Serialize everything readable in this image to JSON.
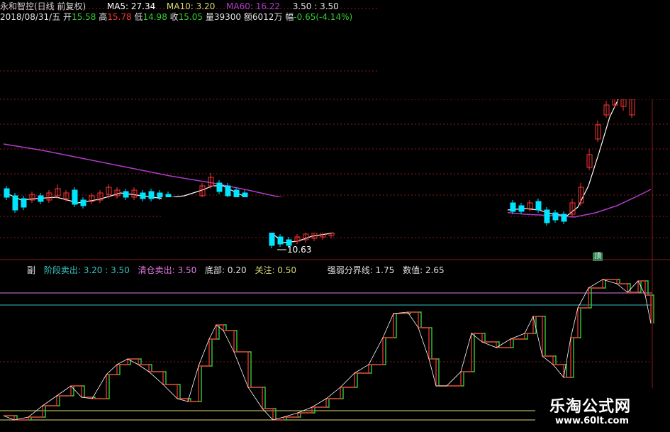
{
  "header": {
    "stock_title": "永和智控(日线 前复权)",
    "ma5_label": "MA5: 27.34",
    "ma10_label": "MA10: 3.20",
    "ma60_label": "MA60: 16.22",
    "tail_value": "3.50 : 3.50",
    "date": "2018/08/31/五",
    "open_label": "开",
    "open_value": "15.58",
    "high_label": "高",
    "high_value": "15.78",
    "low_label": "低",
    "low_value": "14.98",
    "close_label": "收",
    "close_value": "15.05",
    "volume_label": "量",
    "volume_value": "39300",
    "amount_label": "额",
    "amount_value": "6012万",
    "change_label": "幅",
    "change_value": "-0.65(-4.14%)"
  },
  "price_annotation": {
    "low_marker": "10.63"
  },
  "badge": {
    "text": "顶"
  },
  "oscillator_legend": {
    "name": "副",
    "stage_sell": "阶段卖出: 3.20 : 3.50",
    "clear_sell": "清仓卖出: 3.50",
    "bottom": "底部: 0.20",
    "attention": "关注: 0.50",
    "divider": "强弱分界线: 1.75",
    "value": "数值: 2.65"
  },
  "watermark": {
    "line1": "乐淘公式网",
    "line2": "www.60lt.com"
  },
  "colors": {
    "background": "#000000",
    "up_candle": "#ff3333",
    "down_candle": "#00e5ff",
    "ma60": "#b03cc8",
    "ma_white": "#ffffff",
    "osc_green": "#33cc33",
    "osc_red": "#e03030",
    "line_pink": "#e078e0",
    "line_cyan": "#38c0c0",
    "line_yellow": "#d8d870",
    "grid": "#8b1a1a"
  },
  "chart_data": {
    "type": "line",
    "series": [
      {
        "name": "阶段卖出",
        "values": [
          3.2,
          3.5
        ]
      },
      {
        "name": "清仓卖出",
        "values": [
          3.5
        ]
      },
      {
        "name": "底部",
        "values": [
          0.2
        ]
      },
      {
        "name": "关注",
        "values": [
          0.5
        ]
      },
      {
        "name": "强弱分界线",
        "values": [
          1.75
        ]
      },
      {
        "name": "数值",
        "values": [
          2.65
        ]
      }
    ]
  }
}
